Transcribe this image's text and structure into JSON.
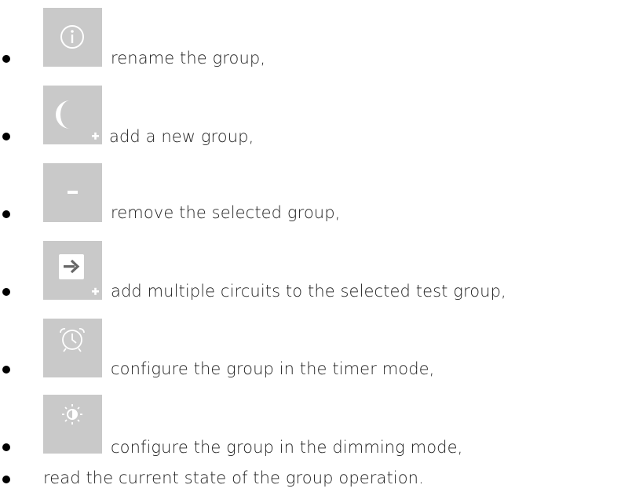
{
  "items": [
    {
      "icon": "info-icon",
      "text": "rename the group,"
    },
    {
      "icon": "moon-plus-icon",
      "text": "add a new group,"
    },
    {
      "icon": "minus-icon",
      "text": "remove the selected group,"
    },
    {
      "icon": "arrow-in-box-plus-icon",
      "text": "add multiple circuits to the selected test group,"
    },
    {
      "icon": "alarm-clock-icon",
      "text": "configure the group in the timer mode,"
    },
    {
      "icon": "sun-dimming-icon",
      "text": "configure the group in the dimming mode,"
    },
    {
      "icon": "",
      "text": "read the current state of the group operation."
    }
  ],
  "colors": {
    "icon_background": "#c9c9c9",
    "icon_foreground": "#ffffff",
    "text": "#222222"
  }
}
